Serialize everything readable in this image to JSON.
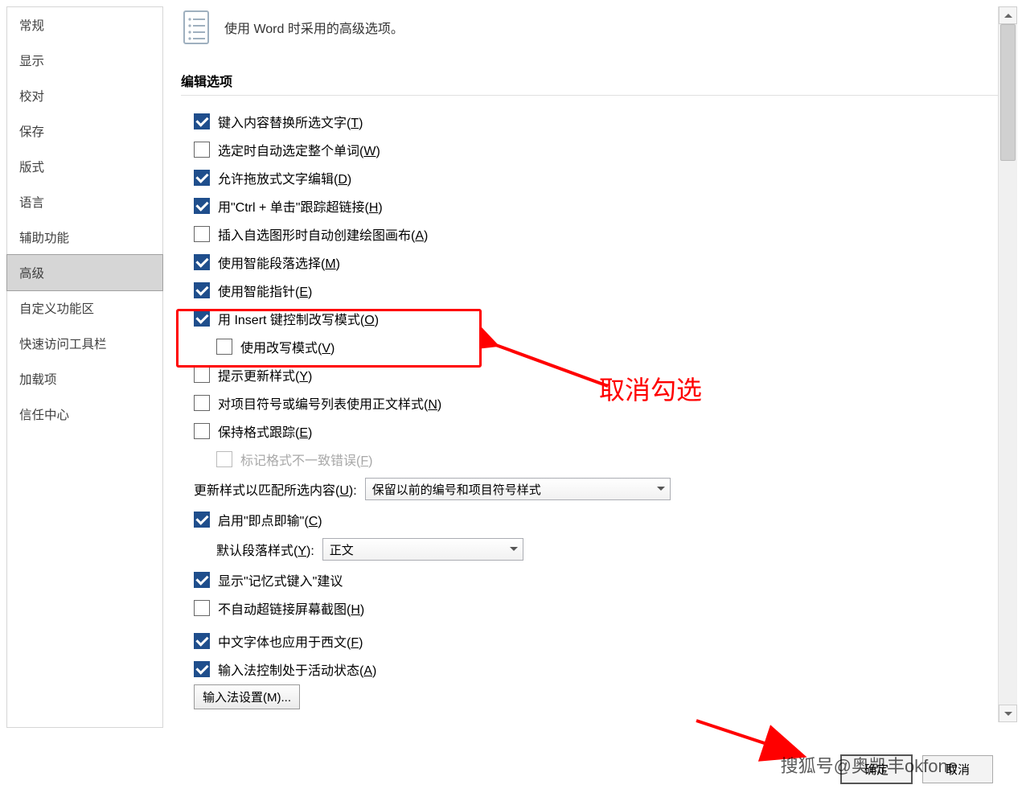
{
  "sidebar": {
    "items": [
      "常规",
      "显示",
      "校对",
      "保存",
      "版式",
      "语言",
      "辅助功能",
      "高级",
      "自定义功能区",
      "快速访问工具栏",
      "加载项",
      "信任中心"
    ],
    "selected_index": 7
  },
  "header": {
    "title": "使用 Word 时采用的高级选项。"
  },
  "section": {
    "title": "编辑选项"
  },
  "opts": [
    {
      "checked": true,
      "label_pre": "键入内容替换所选文字(",
      "hot": "T",
      "label_post": ")"
    },
    {
      "checked": false,
      "label_pre": "选定时自动选定整个单词(",
      "hot": "W",
      "label_post": ")"
    },
    {
      "checked": true,
      "label_pre": "允许拖放式文字编辑(",
      "hot": "D",
      "label_post": ")"
    },
    {
      "checked": true,
      "label_pre": "用\"Ctrl + 单击\"跟踪超链接(",
      "hot": "H",
      "label_post": ")"
    },
    {
      "checked": false,
      "label_pre": "插入自选图形时自动创建绘图画布(",
      "hot": "A",
      "label_post": ")"
    },
    {
      "checked": true,
      "label_pre": "使用智能段落选择(",
      "hot": "M",
      "label_post": ")"
    },
    {
      "checked": true,
      "label_pre": "使用智能指针(",
      "hot": "E",
      "label_post": ")"
    },
    {
      "checked": true,
      "label_pre": "用 Insert 键控制改写模式(",
      "hot": "O",
      "label_post": ")"
    },
    {
      "checked": false,
      "indent": true,
      "label_pre": "使用改写模式(",
      "hot": "V",
      "label_post": ")"
    },
    {
      "checked": false,
      "label_pre": "提示更新样式(",
      "hot": "Y",
      "label_post": ")"
    },
    {
      "checked": false,
      "label_pre": "对项目符号或编号列表使用正文样式(",
      "hot": "N",
      "label_post": ")"
    },
    {
      "checked": false,
      "label_pre": "保持格式跟踪(",
      "hot": "E",
      "label_post": ")"
    },
    {
      "checked": false,
      "indent": true,
      "disabled": true,
      "label_pre": "标记格式不一致错误(",
      "hot": "F",
      "label_post": ")"
    }
  ],
  "style_update": {
    "label_pre": "更新样式以匹配所选内容(",
    "hot": "U",
    "label_post": "):",
    "value": "保留以前的编号和项目符号样式"
  },
  "opts2": [
    {
      "checked": true,
      "label_pre": "启用\"即点即输\"(",
      "hot": "C",
      "label_post": ")"
    }
  ],
  "para_style": {
    "label_pre": "默认段落样式(",
    "hot": "Y",
    "label_post": "):",
    "value": "正文"
  },
  "opts3": [
    {
      "checked": true,
      "label_pre": "显示\"记忆式键入\"建议",
      "hot": "",
      "label_post": ""
    },
    {
      "checked": false,
      "label_pre": "不自动超链接屏幕截图(",
      "hot": "H",
      "label_post": ")"
    },
    {
      "checked": true,
      "label_pre": "中文字体也应用于西文(",
      "hot": "F",
      "label_post": ")"
    },
    {
      "checked": true,
      "label_pre": "输入法控制处于活动状态(",
      "hot": "A",
      "label_post": ")"
    }
  ],
  "ime_button": {
    "label_pre": "输入法设置(",
    "hot": "M",
    "label_post": ")..."
  },
  "annotation": {
    "text": "取消勾选"
  },
  "buttons": {
    "ok": "确定",
    "cancel": "取消"
  },
  "watermark": "搜狐号@奥凯丰okfone"
}
